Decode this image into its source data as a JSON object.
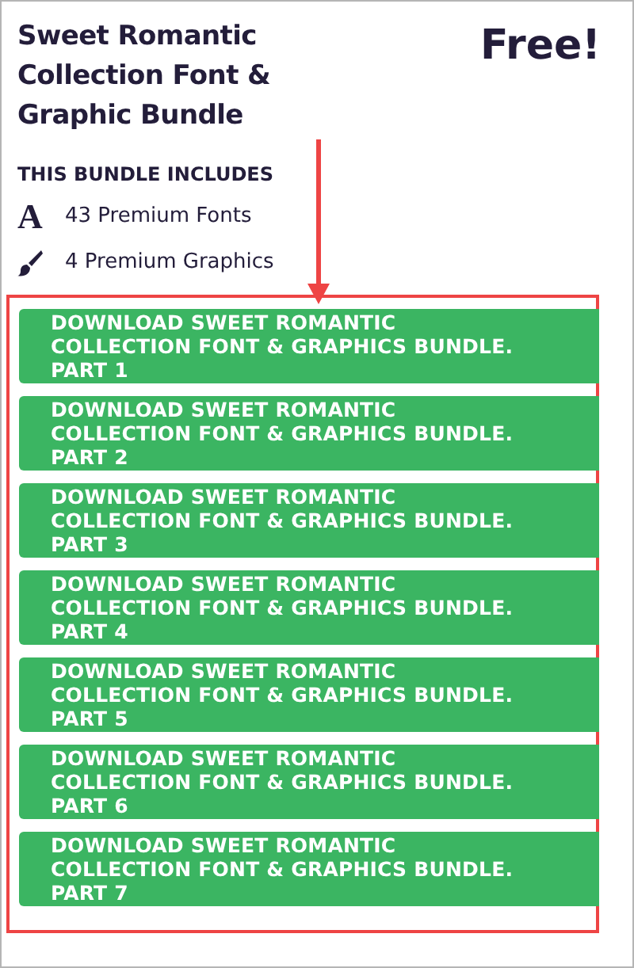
{
  "title": "Sweet Romantic Collection Font & Graphic Bundle",
  "price": "Free!",
  "includes_heading": "THIS BUNDLE INCLUDES",
  "includes": [
    {
      "kind": "font",
      "label": "43 Premium Fonts",
      "icon_text": "A"
    },
    {
      "kind": "graphic",
      "label": "4 Premium Graphics"
    }
  ],
  "downloads": [
    "DOWNLOAD SWEET ROMANTIC COLLECTION FONT & GRAPHICS BUNDLE. PART 1",
    "DOWNLOAD SWEET ROMANTIC COLLECTION FONT & GRAPHICS BUNDLE. PART 2",
    "DOWNLOAD SWEET ROMANTIC COLLECTION FONT & GRAPHICS BUNDLE. PART 3",
    "DOWNLOAD SWEET ROMANTIC COLLECTION FONT & GRAPHICS BUNDLE. PART 4",
    "DOWNLOAD SWEET ROMANTIC COLLECTION FONT & GRAPHICS BUNDLE. PART 5",
    "DOWNLOAD SWEET ROMANTIC COLLECTION FONT & GRAPHICS BUNDLE. PART 6",
    "DOWNLOAD SWEET ROMANTIC COLLECTION FONT & GRAPHICS BUNDLE. PART 7"
  ]
}
